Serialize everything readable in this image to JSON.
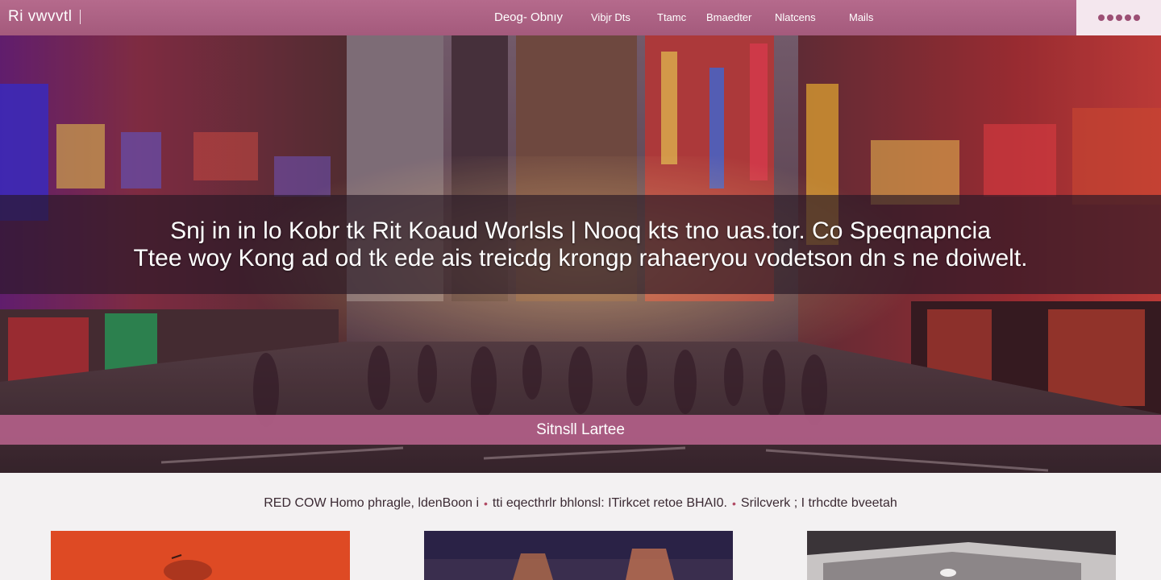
{
  "header": {
    "brand": "Ri vwvvtl",
    "nav": [
      "Deog- Obnıy",
      "Vibjr Dts",
      "Ttamc",
      "Bmaedter",
      "Nlatcens",
      "Mails"
    ],
    "menu_icon": "more-dots-icon"
  },
  "hero": {
    "caption_line1": "Snj   in in lo  Kobr tk Rit Koaud Worlsls | Nooq kts tno  uas.tor. Co Speqnapncia",
    "caption_line2": "Ttee woy  Kong ad od  tk ede  ais treicdg krongp rahaeryou  vodetson  dn s  ne doiwelt.",
    "cta_label": "Sitnsll Lartee"
  },
  "info": {
    "segments": [
      "RED COW Homo phragle, ldenBoon i",
      "tti eqecthrlr bhlonsl: ITirkcet retoe BHAI0.",
      "Srilcverk ; I trhcdte bveetah"
    ],
    "bullet_color": "#b04a64"
  },
  "colors": {
    "accent": "#b56a8c",
    "accent_dark": "#9c4f74",
    "cta_band": "#b26088"
  }
}
